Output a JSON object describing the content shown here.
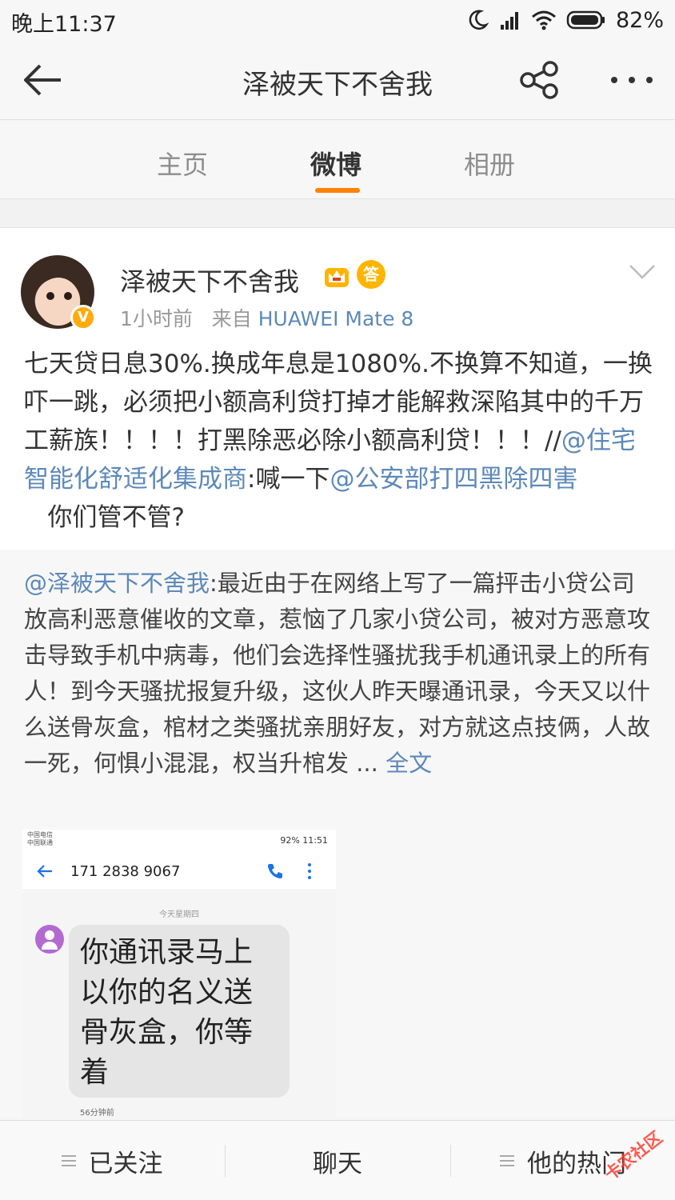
{
  "status_bar": {
    "time": "晚上11:37",
    "battery": "82%"
  },
  "nav": {
    "title": "泽被天下不舍我"
  },
  "tabs": [
    {
      "label": "主页"
    },
    {
      "label": "微博"
    },
    {
      "label": "相册"
    }
  ],
  "post": {
    "user_name": "泽被天下不舍我",
    "time_ago": "1小时前",
    "from_label": "来自",
    "source": "HUAWEI Mate 8",
    "text_part1": "七天贷日息30%.换成年息是1080%.不换算不知道，一换吓一跳，必须把小额高利贷打掉才能解救深陷其中的千万工薪族！！！！打黑除恶必除小额高利贷！！！//",
    "mention1": "@住宅智能化舒适化集成商",
    "text_part2": ":喊一下",
    "mention2": "@公安部打四黑除四害",
    "text_part3": "   你们管不管?"
  },
  "repost": {
    "mention": "@泽被天下不舍我",
    "text": ":最近由于在网络上写了一篇抨击小贷公司放高利恶意催收的文章，惹恼了几家小贷公司，被对方恶意攻击导致手机中病毒，他们会选择性骚扰我手机通讯录上的所有人！到今天骚扰报复升级，这伙人昨天曝通讯录，今天又以什么送骨灰盒，棺材之类骚扰亲朋好友，对方就这点技俩，人故一死，何惧小混混，权当升棺发 ... ",
    "more": "全文"
  },
  "embedded_screenshot": {
    "carrier1": "中国电信",
    "carrier2": "中国联通",
    "status_right": "92%  11:51",
    "phone_number": "171 2838 9067",
    "day": "今天星期四",
    "message": "你通讯录马上以你的名义送骨灰盒，你等着",
    "time": "56分钟前"
  },
  "toolbar": {
    "follow": "已关注",
    "chat": "聊天",
    "hot": "他的热门"
  },
  "watermark": "卡农社区",
  "colors": {
    "accent": "#ff8200",
    "link": "#5d89b8",
    "verified": "#ffab0c"
  }
}
